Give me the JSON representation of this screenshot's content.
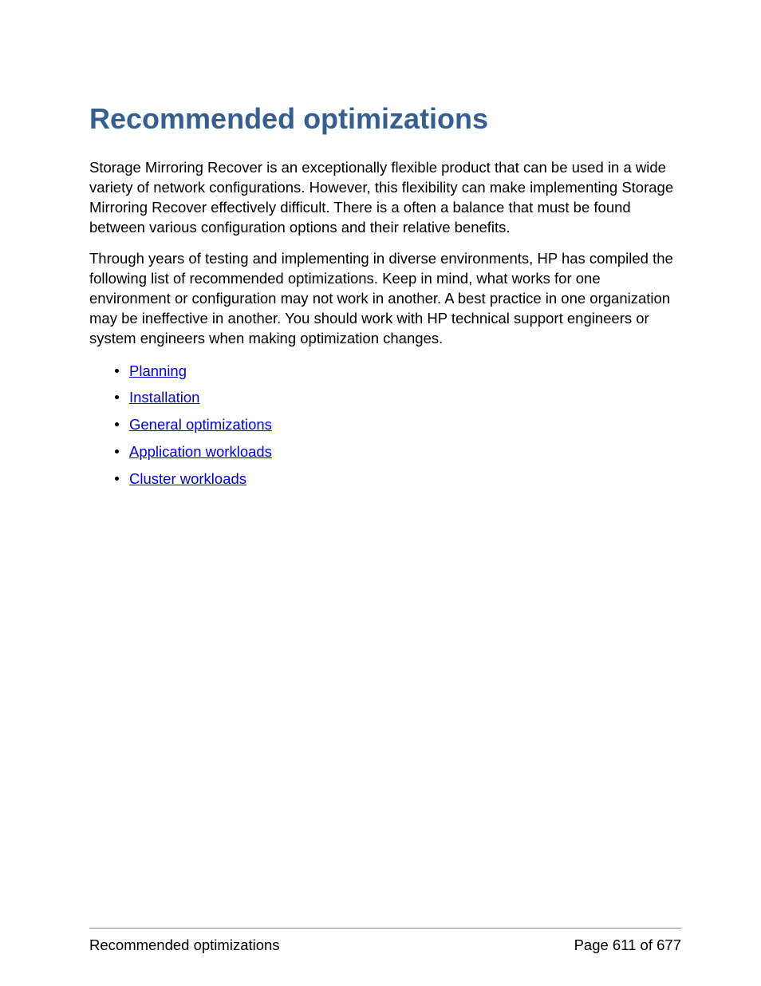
{
  "heading": "Recommended optimizations",
  "paragraphs": [
    "Storage Mirroring Recover is an exceptionally flexible product that can be used in a wide variety of network configurations. However, this flexibility can make implementing Storage Mirroring Recover effectively difficult. There is a often a balance that must be found between various configuration options and their relative benefits.",
    "Through years of testing and implementing in diverse environments, HP has compiled the following list of recommended optimizations. Keep in mind, what works for one environment or configuration may not work in another. A best practice in one organization may be ineffective in another. You should work with HP technical support engineers or system engineers when making optimization changes."
  ],
  "links": [
    "Planning",
    "Installation",
    "General optimizations",
    "Application workloads",
    "Cluster workloads"
  ],
  "footer": {
    "title": "Recommended optimizations",
    "page_label": "Page 611 of 677"
  }
}
